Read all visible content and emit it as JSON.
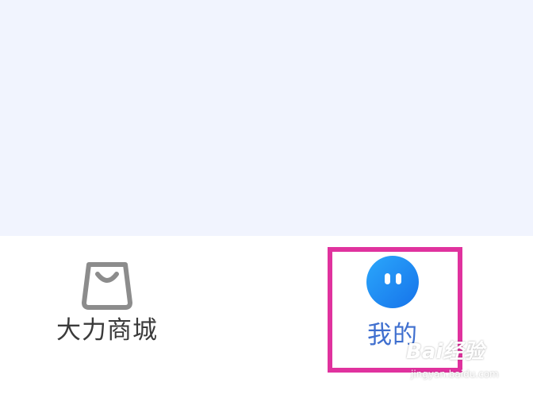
{
  "tab_bar": {
    "tabs": [
      {
        "label": "大力商城",
        "icon": "shopping-bag-icon",
        "active": false
      },
      {
        "label": "我的",
        "icon": "smiley-face-icon",
        "active": true
      }
    ]
  },
  "watermark": {
    "brand": "Bai经验",
    "url": "jingyan.baidu.com"
  },
  "colors": {
    "content_bg": "#f1f4fe",
    "tab_bar_bg": "#ffffff",
    "active_label": "#3f6fcf",
    "inactive_label": "#3a3a3a",
    "inactive_icon": "#8c8c8c",
    "active_icon": "#1e8ff5",
    "highlight": "#e0329e"
  }
}
